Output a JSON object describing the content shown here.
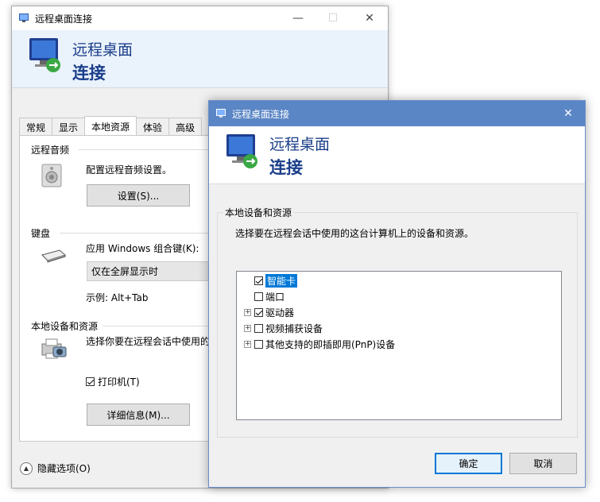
{
  "back_window": {
    "title": "远程桌面连接",
    "banner_line1": "远程桌面",
    "banner_line2": "连接",
    "tabs": [
      "常规",
      "显示",
      "本地资源",
      "体验",
      "高级"
    ],
    "audio": {
      "group_label": "远程音频",
      "desc": "配置远程音频设置。",
      "button": "设置(S)..."
    },
    "keyboard": {
      "group_label": "键盘",
      "desc": "应用 Windows 组合键(K):",
      "select_value": "仅在全屏显示时",
      "example": "示例: Alt+Tab"
    },
    "local": {
      "group_label": "本地设备和资源",
      "desc": "选择你要在远程会话中使用的",
      "printer_label": "打印机(T)",
      "details_button": "详细信息(M)..."
    },
    "hide_options": "隐藏选项(O)"
  },
  "front_window": {
    "title": "远程桌面连接",
    "banner_line1": "远程桌面",
    "banner_line2": "连接",
    "group_label": "本地设备和资源",
    "instruction": "选择要在远程会话中使用的这台计算机上的设备和资源。",
    "tree": [
      {
        "label": "智能卡",
        "checked": true,
        "expander": false,
        "selected": true
      },
      {
        "label": "端口",
        "checked": false,
        "expander": false,
        "selected": false
      },
      {
        "label": "驱动器",
        "checked": true,
        "expander": true,
        "selected": false
      },
      {
        "label": "视频捕获设备",
        "checked": false,
        "expander": true,
        "selected": false
      },
      {
        "label": "其他支持的即插即用(PnP)设备",
        "checked": false,
        "expander": true,
        "selected": false
      }
    ],
    "ok_button": "确定",
    "cancel_button": "取消"
  },
  "colors": {
    "accent_titlebar": "#5b86c5",
    "banner_text": "#1a3e8a",
    "selection": "#0078d7"
  }
}
